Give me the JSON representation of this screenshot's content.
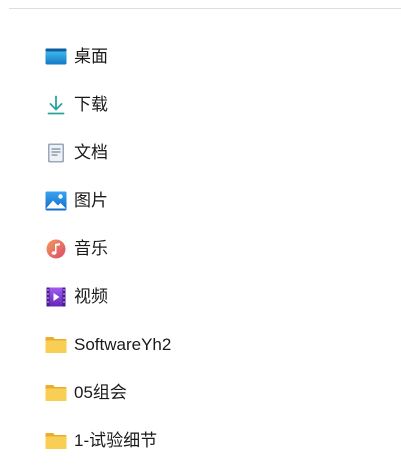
{
  "quick_access": {
    "items": [
      {
        "label": "桌面",
        "icon": "desktop-icon"
      },
      {
        "label": "下载",
        "icon": "download-icon"
      },
      {
        "label": "文档",
        "icon": "document-icon"
      },
      {
        "label": "图片",
        "icon": "pictures-icon"
      },
      {
        "label": "音乐",
        "icon": "music-icon"
      },
      {
        "label": "视频",
        "icon": "video-icon"
      },
      {
        "label": "SoftwareYh2",
        "icon": "folder-icon"
      },
      {
        "label": "05组会",
        "icon": "folder-icon"
      },
      {
        "label": "1-试验细节",
        "icon": "folder-icon"
      }
    ]
  },
  "colors": {
    "folder": "#F5C344",
    "desktop": "#1E8FD6",
    "download": "#2AA39A",
    "music": "#E0645A",
    "video": "#7B3FD0",
    "divider": "#DDDDDD"
  }
}
